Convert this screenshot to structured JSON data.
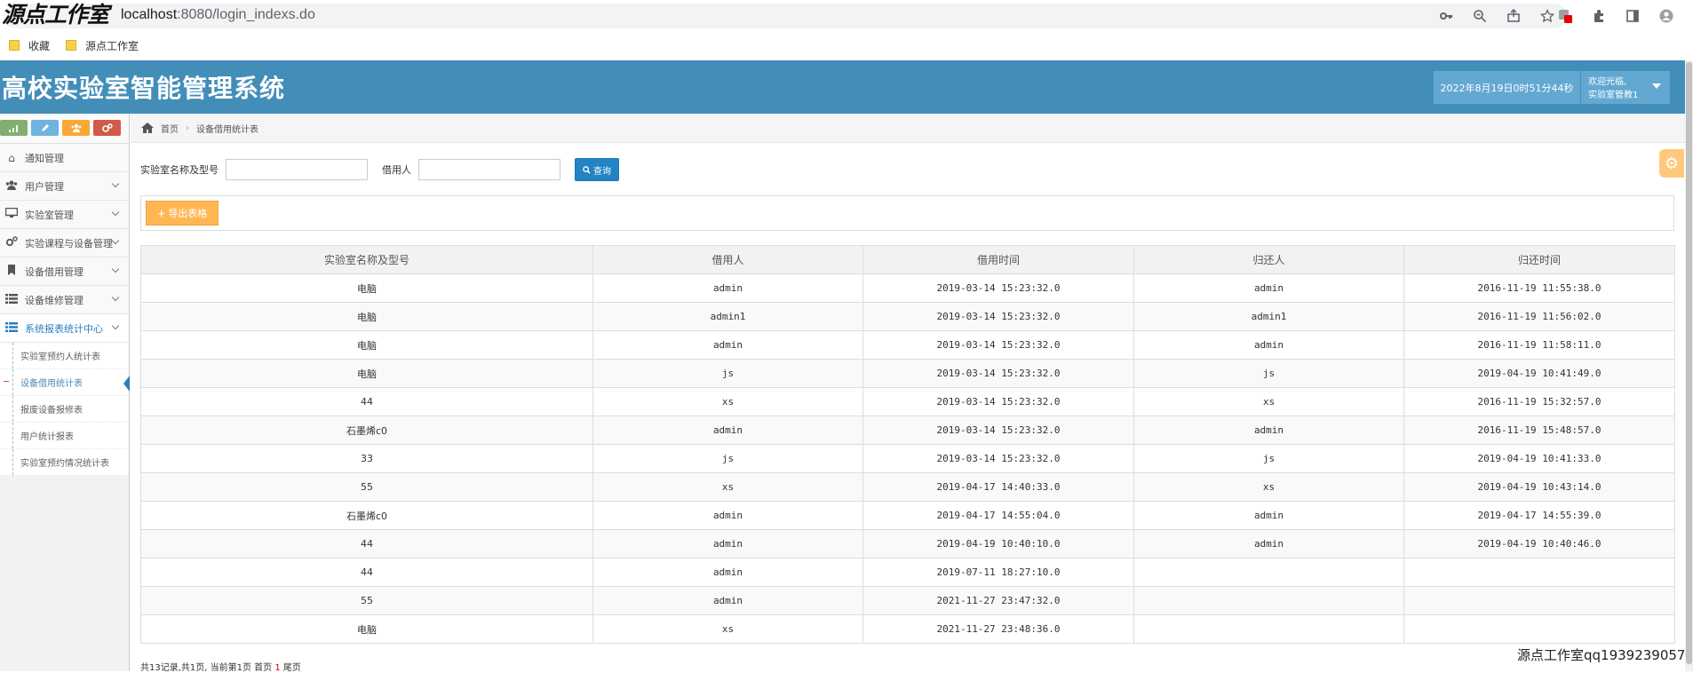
{
  "browser": {
    "watermark_text": "源点工作室",
    "url_host": "localhost",
    "url_path": ":8080/login_indexs.do",
    "bookmarks": [
      {
        "label": "收藏"
      },
      {
        "label": "源点工作室"
      }
    ]
  },
  "header": {
    "title": "高校实验室智能管理系统",
    "datetime": "2022年8月19日0时51分44秒",
    "welcome": "欢迎光临,",
    "user_role": "实验室管教1",
    "bg_color": "#438eb9"
  },
  "sidebar": {
    "nav": [
      {
        "label": "通知管理",
        "icon": "home-icon",
        "chevron": false
      },
      {
        "label": "用户管理",
        "icon": "users-icon",
        "chevron": true
      },
      {
        "label": "实验室管理",
        "icon": "desktop-icon",
        "chevron": true
      },
      {
        "label": "实验课程与设备管理",
        "icon": "cogs-icon",
        "chevron": true
      },
      {
        "label": "设备借用管理",
        "icon": "bookmark-icon",
        "chevron": true
      },
      {
        "label": "设备维修管理",
        "icon": "list-icon",
        "chevron": true
      },
      {
        "label": "系统报表统计中心",
        "icon": "list-icon",
        "chevron": true
      }
    ],
    "sub_items": [
      {
        "label": "实验室预约人统计表"
      },
      {
        "label": "设备借用统计表"
      },
      {
        "label": "报废设备报修表"
      },
      {
        "label": "用户统计报表"
      },
      {
        "label": "实验室预约情况统计表"
      }
    ]
  },
  "breadcrumb": {
    "home": "首页",
    "current": "设备借用统计表"
  },
  "search": {
    "name_label": "实验室名称及型号",
    "name_value": "",
    "borrower_label": "借用人",
    "borrower_value": "",
    "button_label": "查询"
  },
  "toolbar": {
    "export_label": "导出表格"
  },
  "table": {
    "headers": [
      "实验室名称及型号",
      "借用人",
      "借用时间",
      "归还人",
      "归还时间"
    ],
    "rows": [
      [
        "电脑",
        "admin",
        "2019-03-14 15:23:32.0",
        "admin",
        "2016-11-19 11:55:38.0"
      ],
      [
        "电脑",
        "admin1",
        "2019-03-14 15:23:32.0",
        "admin1",
        "2016-11-19 11:56:02.0"
      ],
      [
        "电脑",
        "admin",
        "2019-03-14 15:23:32.0",
        "admin",
        "2016-11-19 11:58:11.0"
      ],
      [
        "电脑",
        "js",
        "2019-03-14 15:23:32.0",
        "js",
        "2019-04-19 10:41:49.0"
      ],
      [
        "44",
        "xs",
        "2019-03-14 15:23:32.0",
        "xs",
        "2016-11-19 15:32:57.0"
      ],
      [
        "石墨烯c0",
        "admin",
        "2019-03-14 15:23:32.0",
        "admin",
        "2016-11-19 15:48:57.0"
      ],
      [
        "33",
        "js",
        "2019-03-14 15:23:32.0",
        "js",
        "2019-04-19 10:41:33.0"
      ],
      [
        "55",
        "xs",
        "2019-04-17 14:40:33.0",
        "xs",
        "2019-04-19 10:43:14.0"
      ],
      [
        "石墨烯c0",
        "admin",
        "2019-04-17 14:55:04.0",
        "admin",
        "2019-04-17 14:55:39.0"
      ],
      [
        "44",
        "admin",
        "2019-04-19 10:40:10.0",
        "admin",
        "2019-04-19 10:40:46.0"
      ],
      [
        "44",
        "admin",
        "2019-07-11 18:27:10.0",
        "",
        ""
      ],
      [
        "55",
        "admin",
        "2021-11-27 23:47:32.0",
        "",
        ""
      ],
      [
        "电脑",
        "xs",
        "2021-11-27 23:48:36.0",
        "",
        ""
      ]
    ]
  },
  "pager": {
    "prefix": "共13记录,共1页, 当前第1页 首页 ",
    "current": "1",
    "suffix": " 尾页"
  },
  "footer_watermark": "源点工作室qq1939239057"
}
